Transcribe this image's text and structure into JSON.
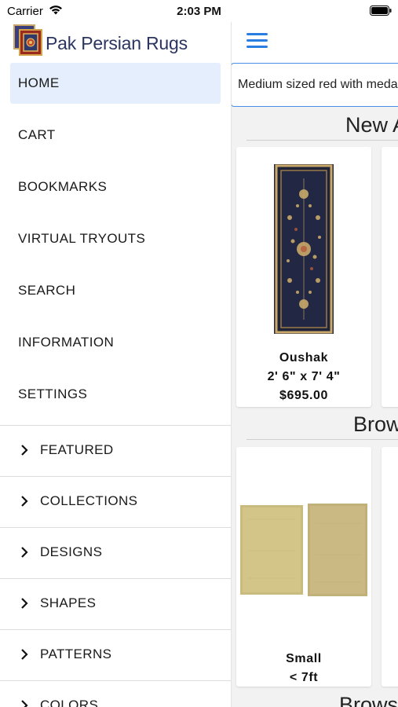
{
  "status_bar": {
    "carrier": "Carrier",
    "time": "2:03 PM"
  },
  "drawer": {
    "app_title": "Pak Persian Rugs",
    "nav_items": [
      {
        "label": "HOME",
        "active": true
      },
      {
        "label": "CART",
        "active": false
      },
      {
        "label": "BOOKMARKS",
        "active": false
      },
      {
        "label": "VIRTUAL TRYOUTS",
        "active": false
      },
      {
        "label": "SEARCH",
        "active": false
      },
      {
        "label": "INFORMATION",
        "active": false
      },
      {
        "label": "SETTINGS",
        "active": false
      }
    ],
    "sections": [
      "FEATURED",
      "COLLECTIONS",
      "DESIGNS",
      "SHAPES",
      "PATTERNS",
      "COLORS"
    ]
  },
  "main": {
    "search_value": "Medium sized red with medallion",
    "section_new": "New A",
    "section_browse": "Brow",
    "section_browse2": "Brows",
    "product": {
      "name": "Oushak",
      "size": "2' 6\" x 7' 4\"",
      "price": "$695.00"
    },
    "browse_card": {
      "title": "Small",
      "subtitle": "< 7ft"
    }
  },
  "colors": {
    "accent": "#2a7de1",
    "active_bg": "#e4eefc",
    "title": "#2b3560"
  }
}
